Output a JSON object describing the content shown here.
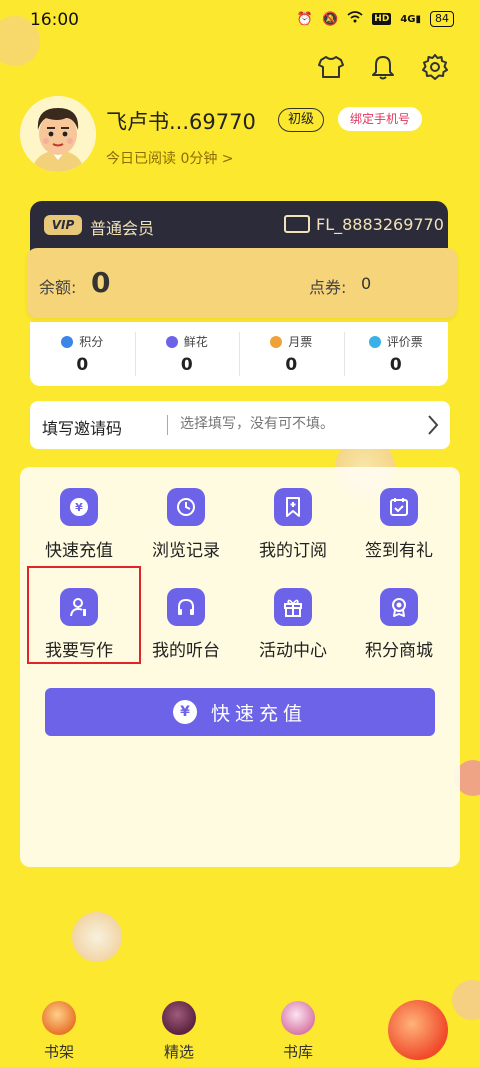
{
  "status_bar": {
    "time": "16:00",
    "network": "4G",
    "hd": "HD",
    "battery": "84"
  },
  "top_actions": [
    "shirt-icon",
    "bell-icon",
    "gear-icon"
  ],
  "profile": {
    "username": "飞卢书...69770",
    "level": "初级",
    "bind_phone": "绑定手机号",
    "read_today": "今日已阅读 0分钟 >"
  },
  "vip": {
    "badge": "VIP",
    "label": "普通会员",
    "id": "FL_8883269770"
  },
  "balance": {
    "balance_label": "余额:",
    "balance_value": "0",
    "coupon_label": "点券:",
    "coupon_value": "0"
  },
  "stats": [
    {
      "label": "积分",
      "value": "0",
      "color": "#3a86e8"
    },
    {
      "label": "鲜花",
      "value": "0",
      "color": "#6c63e8"
    },
    {
      "label": "月票",
      "value": "0",
      "color": "#f0a23a"
    },
    {
      "label": "评价票",
      "value": "0",
      "color": "#3ab0e8"
    }
  ],
  "invite": {
    "title": "填写邀请码",
    "placeholder": "选择填写，没有可不填。"
  },
  "grid": [
    {
      "label": "快速充值",
      "icon": "yen-chat-icon"
    },
    {
      "label": "浏览记录",
      "icon": "history-icon"
    },
    {
      "label": "我的订阅",
      "icon": "bookmark-plus-icon"
    },
    {
      "label": "签到有礼",
      "icon": "calendar-check-icon"
    },
    {
      "label": "我要写作",
      "icon": "writer-icon"
    },
    {
      "label": "我的听台",
      "icon": "headphones-icon"
    },
    {
      "label": "活动中心",
      "icon": "gift-icon"
    },
    {
      "label": "积分商城",
      "icon": "medal-icon"
    }
  ],
  "recharge_button": {
    "label": "快速充值",
    "icon": "¥"
  },
  "bottom_nav": [
    {
      "label": "书架"
    },
    {
      "label": "精选"
    },
    {
      "label": "书库"
    }
  ],
  "colors": {
    "background": "#fbe82f",
    "accent": "#6c63e8",
    "highlight": "#e3232a",
    "vip_card": "#2b2b3a"
  }
}
